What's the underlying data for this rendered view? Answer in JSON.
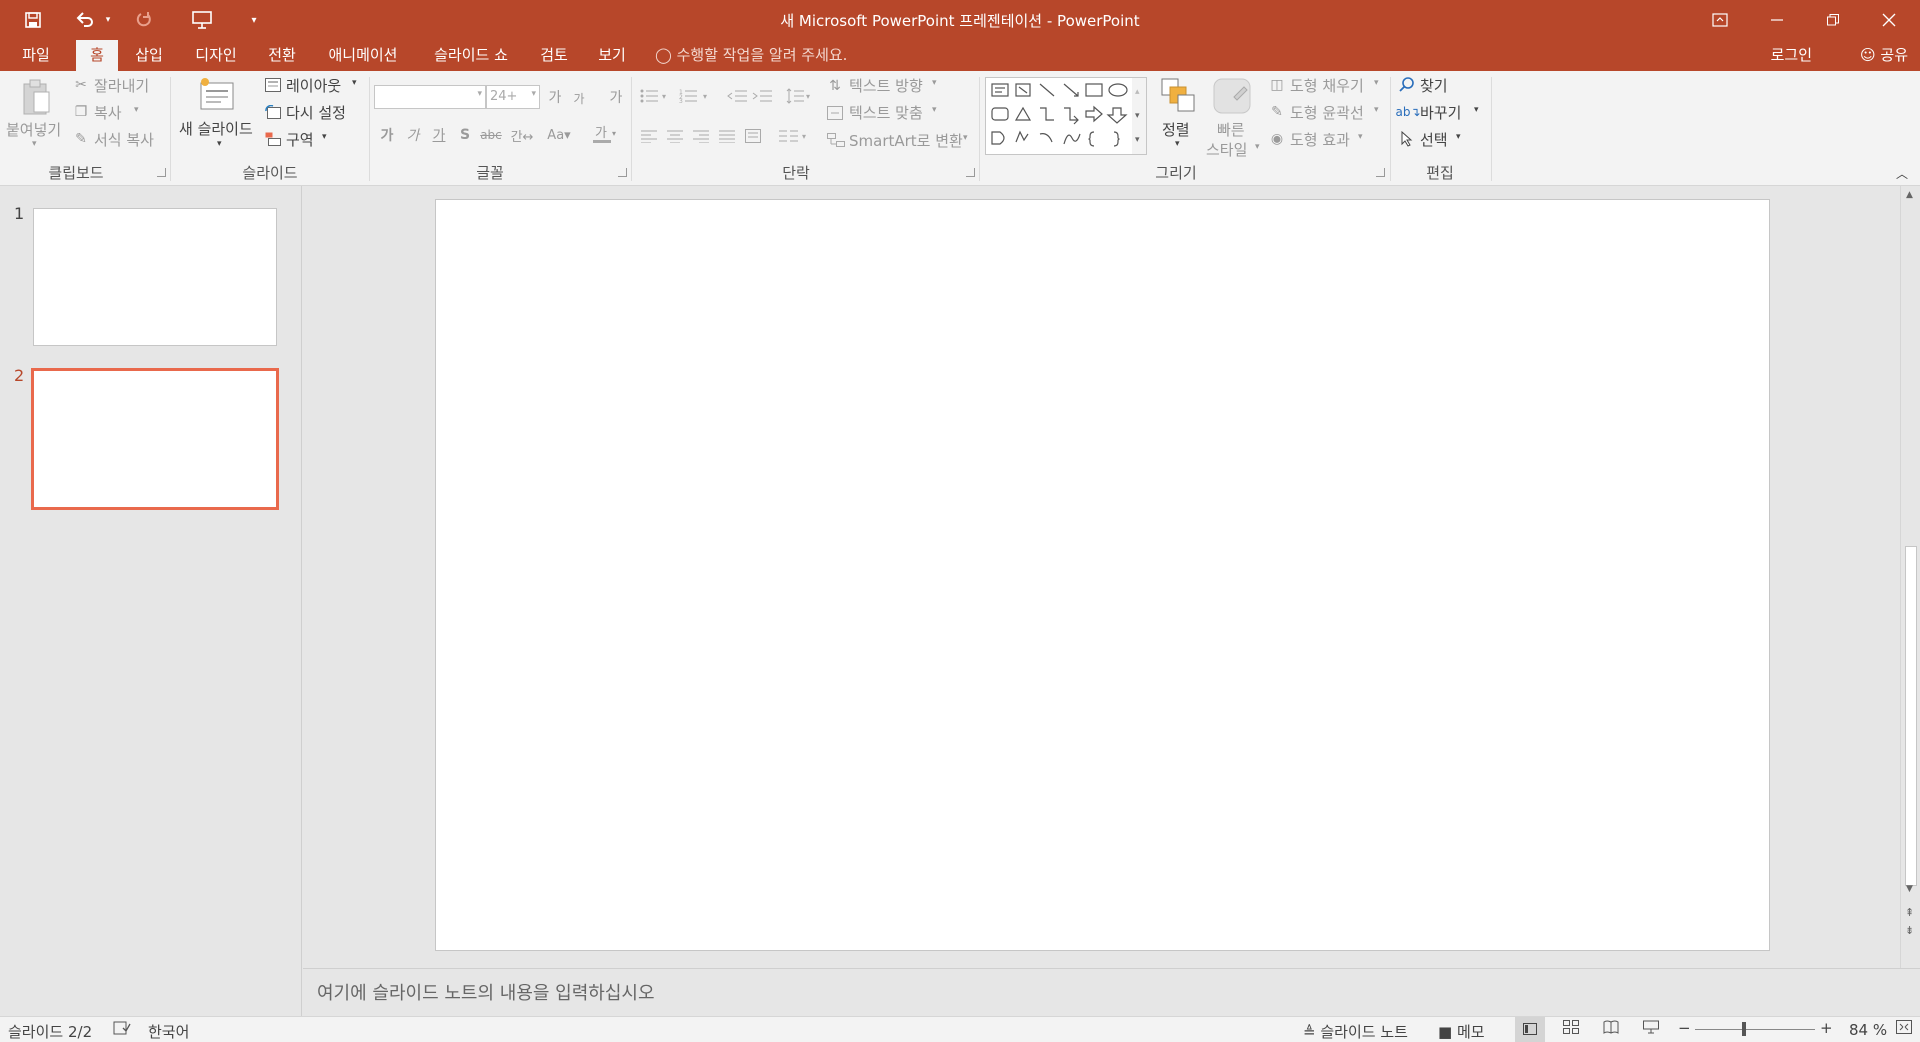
{
  "window": {
    "title": "새 Microsoft PowerPoint 프레젠테이션 - PowerPoint",
    "accent_color": "#b7472a"
  },
  "quick_access": {
    "icons": [
      "save-icon",
      "undo-icon",
      "redo-icon",
      "slideshow-from-beginning-icon",
      "customize-dropdown-icon"
    ]
  },
  "tabs": [
    {
      "label": "파일",
      "active": false
    },
    {
      "label": "홈",
      "active": true
    },
    {
      "label": "삽입",
      "active": false
    },
    {
      "label": "디자인",
      "active": false
    },
    {
      "label": "전환",
      "active": false
    },
    {
      "label": "애니메이션",
      "active": false
    },
    {
      "label": "슬라이드 쇼",
      "active": false
    },
    {
      "label": "검토",
      "active": false
    },
    {
      "label": "보기",
      "active": false
    }
  ],
  "tell_me": "수행할 작업을 알려 주세요.",
  "account": {
    "login": "로그인",
    "share": "공유"
  },
  "ribbon": {
    "clipboard": {
      "paste": "붙여넣기",
      "cut": "잘라내기",
      "copy": "복사",
      "format_painter": "서식 복사",
      "label": "클립보드"
    },
    "slides": {
      "new_slide": "새 슬라이드",
      "layout": "레이아웃",
      "reset": "다시 설정",
      "section": "구역",
      "label": "슬라이드"
    },
    "font": {
      "font_name": "",
      "font_size": "24+",
      "label": "글꼴"
    },
    "paragraph": {
      "text_direction": "텍스트 방향",
      "align_text": "텍스트 맞춤",
      "smartart": "SmartArt로 변환",
      "label": "단락"
    },
    "drawing": {
      "arrange": "정렬",
      "quick_styles_1": "빠른",
      "quick_styles_2": "스타일",
      "shape_fill": "도형 채우기",
      "shape_outline": "도형 윤곽선",
      "shape_effects": "도형 효과",
      "label": "그리기"
    },
    "editing": {
      "find": "찾기",
      "replace": "바꾸기",
      "select": "선택",
      "label": "편집"
    }
  },
  "slides": [
    {
      "number": "1",
      "selected": false
    },
    {
      "number": "2",
      "selected": true
    }
  ],
  "notes_placeholder": "여기에 슬라이드 노트의 내용을 입력하십시오",
  "status": {
    "slide_counter": "슬라이드 2/2",
    "language": "한국어",
    "notes": "슬라이드 노트",
    "comments": "메모",
    "zoom": "84 %",
    "zoom_level": 0.84
  }
}
